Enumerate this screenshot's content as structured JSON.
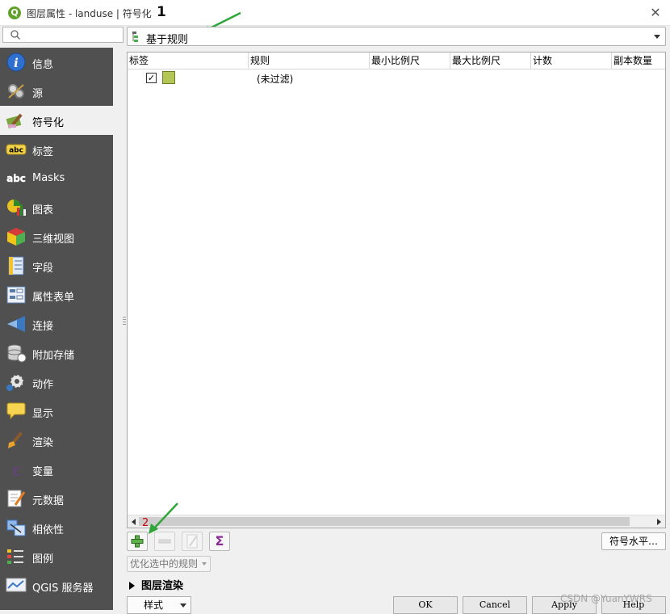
{
  "window": {
    "title": "图层属性 - landuse | 符号化",
    "annotation1": "1",
    "close_glyph": "✕"
  },
  "sidebar": {
    "search_placeholder": "",
    "items": [
      {
        "label": "信息",
        "icon": "info-icon"
      },
      {
        "label": "源",
        "icon": "source-icon"
      },
      {
        "label": "符号化",
        "icon": "symbology-icon",
        "active": true
      },
      {
        "label": "标签",
        "icon": "labels-icon"
      },
      {
        "label": "Masks",
        "icon": "masks-icon"
      },
      {
        "label": "图表",
        "icon": "diagram-icon"
      },
      {
        "label": "三维视图",
        "icon": "3d-view-icon"
      },
      {
        "label": "字段",
        "icon": "fields-icon"
      },
      {
        "label": "属性表单",
        "icon": "attributes-form-icon"
      },
      {
        "label": "连接",
        "icon": "joins-icon"
      },
      {
        "label": "附加存储",
        "icon": "auxiliary-storage-icon"
      },
      {
        "label": "动作",
        "icon": "actions-icon"
      },
      {
        "label": "显示",
        "icon": "display-icon"
      },
      {
        "label": "渲染",
        "icon": "rendering-icon"
      },
      {
        "label": "变量",
        "icon": "variables-icon"
      },
      {
        "label": "元数据",
        "icon": "metadata-icon"
      },
      {
        "label": "相依性",
        "icon": "dependencies-icon"
      },
      {
        "label": "图例",
        "icon": "legend-icon"
      },
      {
        "label": "QGIS 服务器",
        "icon": "qgis-server-icon"
      }
    ]
  },
  "renderer": {
    "selected": "基于规则"
  },
  "rules_table": {
    "columns": [
      "标签",
      "规则",
      "最小比例尺",
      "最大比例尺",
      "计数",
      "副本数量"
    ],
    "rows": [
      {
        "checked": true,
        "label": "",
        "rule": "(未过滤)",
        "min_scale": "",
        "max_scale": "",
        "count": "",
        "duplicate_count": "",
        "symbol_color": "#b3c552"
      }
    ]
  },
  "toolbar": {
    "annotation2": "2",
    "sigma_glyph": "Σ",
    "symbol_levels_label": "符号水平…",
    "refine_label": "优化选中的规则"
  },
  "layer_rendering": {
    "label": "图层渲染"
  },
  "dialog_buttons": {
    "style_label": "样式",
    "ok_label": "OK",
    "cancel_label": "Cancel",
    "apply_label": "Apply",
    "help_label": "Help"
  },
  "watermark": "CSDN @YuanYWRS"
}
